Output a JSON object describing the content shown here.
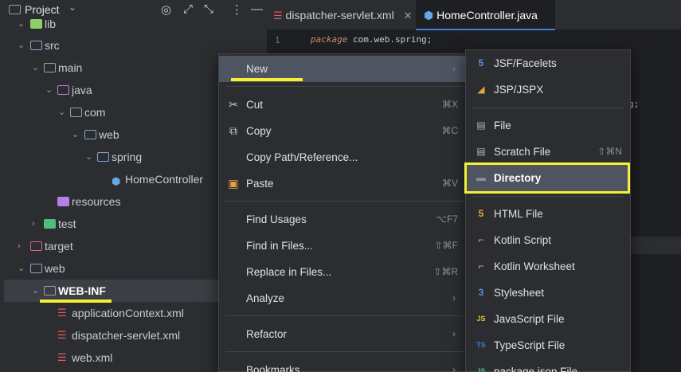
{
  "project_panel": {
    "title": "Project",
    "tree": [
      {
        "label": "lib",
        "kind": "lib"
      },
      {
        "label": "src",
        "kind": "src"
      },
      {
        "label": "main",
        "kind": "folder"
      },
      {
        "label": "java",
        "kind": "java"
      },
      {
        "label": "com",
        "kind": "folder"
      },
      {
        "label": "web",
        "kind": "web"
      },
      {
        "label": "spring",
        "kind": "web"
      },
      {
        "label": "HomeController",
        "kind": "class"
      },
      {
        "label": "resources",
        "kind": "res"
      },
      {
        "label": "test",
        "kind": "test"
      },
      {
        "label": "target",
        "kind": "target"
      },
      {
        "label": "web",
        "kind": "web"
      },
      {
        "label": "WEB-INF",
        "kind": "folder"
      },
      {
        "label": "applicationContext.xml",
        "kind": "xml"
      },
      {
        "label": "dispatcher-servlet.xml",
        "kind": "xml"
      },
      {
        "label": "web.xml",
        "kind": "xml"
      }
    ]
  },
  "editor": {
    "tabs": [
      {
        "label": "dispatcher-servlet.xml",
        "active": false
      },
      {
        "label": "HomeController.java",
        "active": true
      }
    ],
    "line_number": "1",
    "code_keyword": "package",
    "code_rest": "com.web.spring;",
    "code_fragment": "g;"
  },
  "context_menu": {
    "items": [
      {
        "label": "New",
        "shortcut": "",
        "submenu": true,
        "icon": ""
      },
      {
        "label": "Cut",
        "shortcut": "⌘X",
        "submenu": false,
        "icon": "scissors-icon"
      },
      {
        "label": "Copy",
        "shortcut": "⌘C",
        "submenu": false,
        "icon": "copy-icon"
      },
      {
        "label": "Copy Path/Reference...",
        "shortcut": "",
        "submenu": false,
        "icon": ""
      },
      {
        "label": "Paste",
        "shortcut": "⌘V",
        "submenu": false,
        "icon": "clipboard-icon"
      },
      {
        "label": "Find Usages",
        "shortcut": "⌥F7",
        "submenu": false,
        "icon": ""
      },
      {
        "label": "Find in Files...",
        "shortcut": "⇧⌘F",
        "submenu": false,
        "icon": ""
      },
      {
        "label": "Replace in Files...",
        "shortcut": "⇧⌘R",
        "submenu": false,
        "icon": ""
      },
      {
        "label": "Analyze",
        "shortcut": "",
        "submenu": true,
        "icon": ""
      },
      {
        "label": "Refactor",
        "shortcut": "",
        "submenu": true,
        "icon": ""
      },
      {
        "label": "Bookmarks",
        "shortcut": "",
        "submenu": true,
        "icon": ""
      }
    ]
  },
  "new_submenu": {
    "items": [
      {
        "label": "JSF/Facelets",
        "shortcut": "",
        "icon_glyph": "5",
        "icon_color": "#5b8de8"
      },
      {
        "label": "JSP/JSPX",
        "shortcut": "",
        "icon_glyph": "◢",
        "icon_color": "#e8a33d"
      },
      {
        "label": "File",
        "shortcut": "",
        "icon_glyph": "▤",
        "icon_color": "#aeb2b8"
      },
      {
        "label": "Scratch File",
        "shortcut": "⇧⌘N",
        "icon_glyph": "▤",
        "icon_color": "#aeb2b8"
      },
      {
        "label": "Directory",
        "shortcut": "",
        "icon_glyph": "▬",
        "icon_color": "#8c9097"
      },
      {
        "label": "HTML File",
        "shortcut": "",
        "icon_glyph": "5",
        "icon_color": "#e8a33d"
      },
      {
        "label": "Kotlin Script",
        "shortcut": "",
        "icon_glyph": "⌐",
        "icon_color": "#d9c23a"
      },
      {
        "label": "Kotlin Worksheet",
        "shortcut": "",
        "icon_glyph": "⌐",
        "icon_color": "#d9c23a"
      },
      {
        "label": "Stylesheet",
        "shortcut": "",
        "icon_glyph": "3",
        "icon_color": "#5b8de8"
      },
      {
        "label": "JavaScript File",
        "shortcut": "",
        "icon_glyph": "JS",
        "icon_color": "#d9c23a"
      },
      {
        "label": "TypeScript File",
        "shortcut": "",
        "icon_glyph": "TS",
        "icon_color": "#3d7fd8"
      },
      {
        "label": "package.json File",
        "shortcut": "",
        "icon_glyph": "JS",
        "icon_color": "#4bc07a"
      }
    ]
  },
  "colors": {
    "highlight_annotation": "#f5f033",
    "menu_highlight": "#4e5461",
    "active_tab_accent": "#3d7fd8"
  }
}
